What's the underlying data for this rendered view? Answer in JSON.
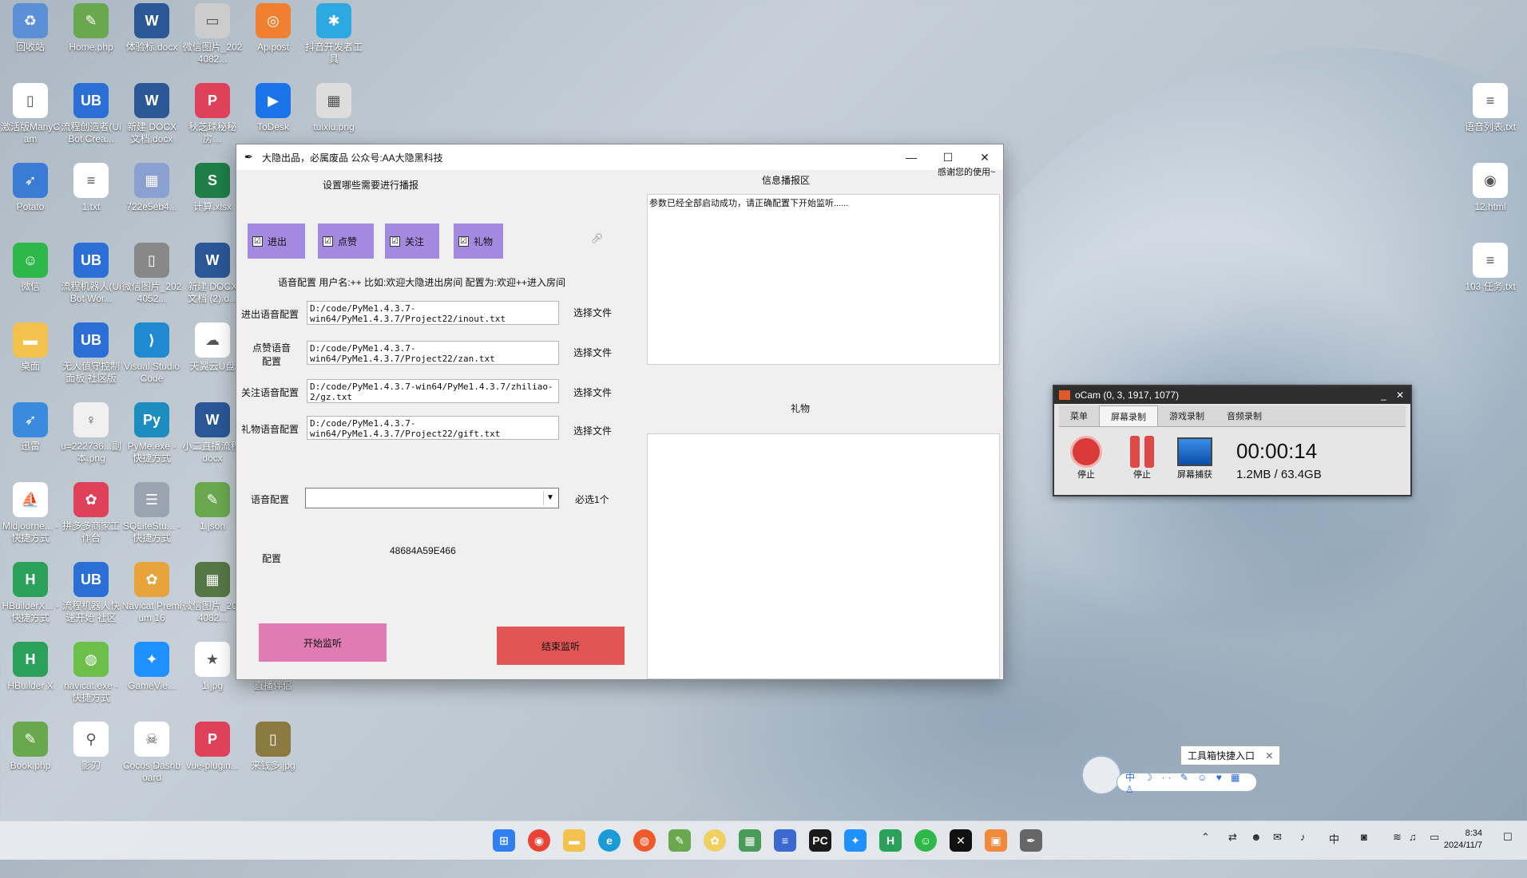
{
  "desktop": {
    "icons": [
      {
        "label": "回收站",
        "color": "#5b8fd6",
        "glyph": "♻"
      },
      {
        "label": "Home.php",
        "color": "#6aa84f",
        "glyph": "✎"
      },
      {
        "label": "体验标.docx",
        "color": "#2b5797",
        "glyph": "W"
      },
      {
        "label": "微信图片_2024082...",
        "color": "#cccccc",
        "glyph": "▭"
      },
      {
        "label": "Apipost",
        "color": "#f08030",
        "glyph": "◎"
      },
      {
        "label": "抖音开发者工具",
        "color": "#2ea8e0",
        "glyph": "✱"
      },
      {
        "label": "激活版ManyCam",
        "color": "#ffffff",
        "glyph": "▯"
      },
      {
        "label": "流程创造者(UiBot Crea...",
        "color": "#2b6fd6",
        "glyph": "UB"
      },
      {
        "label": "新建 DOCX 文档.docx",
        "color": "#2b5797",
        "glyph": "W"
      },
      {
        "label": "秋芝球秘秘房…",
        "color": "#e0415a",
        "glyph": "P"
      },
      {
        "label": "ToDesk",
        "color": "#1a73e8",
        "glyph": "▶"
      },
      {
        "label": "tuixiu.png",
        "color": "#dddddd",
        "glyph": "▦"
      },
      {
        "label": "Potato",
        "color": "#3a7bd5",
        "glyph": "➶"
      },
      {
        "label": "1.txt",
        "color": "#ffffff",
        "glyph": "≡"
      },
      {
        "label": "722e5eb4...",
        "color": "#8aa0d0",
        "glyph": "▦"
      },
      {
        "label": "计算.xlsx",
        "color": "#1e7e45",
        "glyph": "S"
      },
      {
        "label": "微信",
        "color": "#2fb84a",
        "glyph": "☺"
      },
      {
        "label": "流程机器人(UiBot Wor...",
        "color": "#2b6fd6",
        "glyph": "UB"
      },
      {
        "label": "微信图片_2024052...",
        "color": "#888888",
        "glyph": "▯"
      },
      {
        "label": "新建 DOCX 文档 (2).d...",
        "color": "#2b5797",
        "glyph": "W"
      },
      {
        "label": "桌面",
        "color": "#f2c14e",
        "glyph": "▬"
      },
      {
        "label": "无人值守控制面板 社区版",
        "color": "#2b6fd6",
        "glyph": "UB"
      },
      {
        "label": "Visual Studio Code",
        "color": "#1f8ad2",
        "glyph": "⟩"
      },
      {
        "label": "天翼云U盘",
        "color": "#ffffff",
        "glyph": "☁"
      },
      {
        "label": "迅雷",
        "color": "#3a8be0",
        "glyph": "➶"
      },
      {
        "label": "u=222736...副本.png",
        "color": "#f0f0f0",
        "glyph": "♀"
      },
      {
        "label": "PyMe.exe - 快捷方式",
        "color": "#1d8cbf",
        "glyph": "Py"
      },
      {
        "label": "小二直播流程.docx",
        "color": "#2b5797",
        "glyph": "W"
      },
      {
        "label": "Midjourne... - 快捷方式",
        "color": "#ffffff",
        "glyph": "⛵"
      },
      {
        "label": "拼多多商家工作台",
        "color": "#e0415a",
        "glyph": "✿"
      },
      {
        "label": "SQLiteStu... - 快捷方式",
        "color": "#9aa4b0",
        "glyph": "☰"
      },
      {
        "label": "1.json",
        "color": "#6aa84f",
        "glyph": "✎"
      },
      {
        "label": "HBuilderX... - 快捷方式",
        "color": "#2aa05a",
        "glyph": "H"
      },
      {
        "label": "流程机器人快速开始 社区",
        "color": "#2b6fd6",
        "glyph": "UB"
      },
      {
        "label": "Navicat Premium 16",
        "color": "#e8a33a",
        "glyph": "✿"
      },
      {
        "label": "微信图片_2024082...",
        "color": "#557744",
        "glyph": "▦"
      },
      {
        "label": "HBuilder X",
        "color": "#2aa05a",
        "glyph": "H"
      },
      {
        "label": "navicat.exe - 快捷方式",
        "color": "#6cc04a",
        "glyph": "◍"
      },
      {
        "label": "GameVie...",
        "color": "#1e90ff",
        "glyph": "✦"
      },
      {
        "label": "1.jpg",
        "color": "#ffffff",
        "glyph": "★"
      },
      {
        "label": "直播伴侣",
        "color": "#7bd0f0",
        "glyph": "♫"
      },
      {
        "label": "Book.php",
        "color": "#6aa84f",
        "glyph": "✎"
      },
      {
        "label": "影刀",
        "color": "#ffffff",
        "glyph": "⚲"
      },
      {
        "label": "Cocos Dashboard",
        "color": "#ffffff",
        "glyph": "☠"
      },
      {
        "label": "vue-plugin...",
        "color": "#e0415a",
        "glyph": "P"
      },
      {
        "label": "来钱多.jpg",
        "color": "#8a7a40",
        "glyph": "▯"
      },
      {
        "label": "语音列表.txt",
        "color": "#ffffff",
        "glyph": "≡"
      },
      {
        "label": "12.html",
        "color": "#ffffff",
        "glyph": "◉"
      },
      {
        "label": "103 任务.txt",
        "color": "#ffffff",
        "glyph": "≡"
      }
    ]
  },
  "app": {
    "title": "大隐出品，必属废品  公众号:AA大隐黑科技",
    "section_broadcast": "设置哪些需要进行播报",
    "checks": [
      {
        "label": "进出",
        "checked": "☑"
      },
      {
        "label": "点赞",
        "checked": "☑"
      },
      {
        "label": "关注",
        "checked": "☑"
      },
      {
        "label": "礼物",
        "checked": "☑"
      }
    ],
    "voice_hint": "语音配置 用户名:++ 比如:欢迎大隐进出房间 配置为:欢迎++进入房间",
    "rows": [
      {
        "label": "进出语音配置",
        "value": "D:/code/PyMe1.4.3.7-win64/PyMe1.4.3.7/Project22/inout.txt",
        "btn": "选择文件"
      },
      {
        "label": "点赞语音\n配置",
        "value": "D:/code/PyMe1.4.3.7-win64/PyMe1.4.3.7/Project22/zan.txt",
        "btn": "选择文件"
      },
      {
        "label": "关注语音配置",
        "value": "D:/code/PyMe1.4.3.7-win64/PyMe1.4.3.7/zhiliao-2/gz.txt",
        "btn": "选择文件"
      },
      {
        "label": "礼物语音配置",
        "value": "D:/code/PyMe1.4.3.7-win64/PyMe1.4.3.7/Project22/gift.txt",
        "btn": "选择文件"
      }
    ],
    "voice_select_label": "语音配置",
    "voice_select_value": "",
    "required_hint": "必选1个",
    "config_label": "配置",
    "config_code": "48684A59E466",
    "start_btn": "开始监听",
    "stop_btn": "结束监听",
    "info_title": "信息播报区",
    "thanks": "感谢您的使用~",
    "info_text": "参数已经全部启动成功，请正确配置下开始监听......",
    "gift_title": "礼物",
    "colors": {
      "check": "#a38ae0",
      "start": "#e07bb4",
      "stop": "#e25555"
    }
  },
  "ocam": {
    "title": "oCam (0, 3, 1917, 1077)",
    "tabs": [
      "菜单",
      "屏幕录制",
      "游戏录制",
      "音频录制"
    ],
    "stop1": "停止",
    "pause": "停止",
    "capture": "屏幕捕获",
    "time": "00:00:14",
    "size": "1.2MB / 63.4GB"
  },
  "ime": {
    "tooltip": "工具箱快捷入口",
    "bar": "中 ☽ ·· ✎ ☺ ♥ ▦ ♙"
  },
  "taskbar": {
    "time": "8:34",
    "date": "2024/11/7"
  }
}
